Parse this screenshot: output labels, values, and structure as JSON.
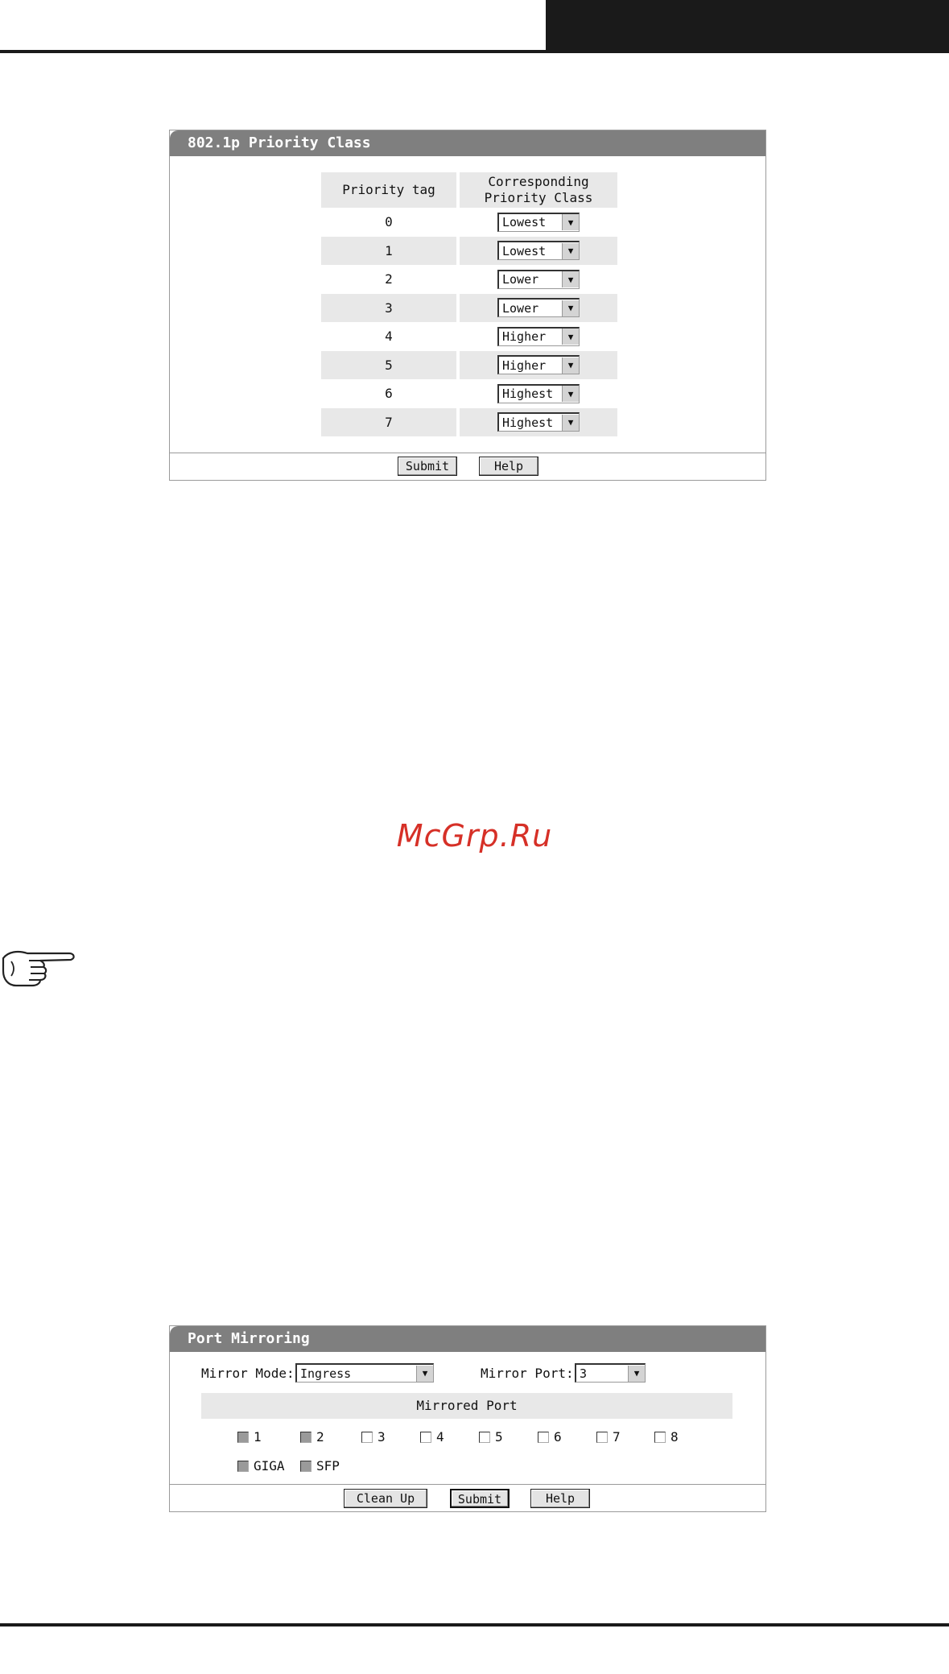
{
  "priority_panel": {
    "title": "802.1p Priority Class",
    "col_tag": "Priority tag",
    "col_class_line1": "Corresponding",
    "col_class_line2": "Priority Class",
    "rows": [
      {
        "tag": "0",
        "class": "Lowest"
      },
      {
        "tag": "1",
        "class": "Lowest"
      },
      {
        "tag": "2",
        "class": "Lower"
      },
      {
        "tag": "3",
        "class": "Lower"
      },
      {
        "tag": "4",
        "class": "Higher"
      },
      {
        "tag": "5",
        "class": "Higher"
      },
      {
        "tag": "6",
        "class": "Highest"
      },
      {
        "tag": "7",
        "class": "Highest"
      }
    ],
    "submit_label": "Submit",
    "help_label": "Help"
  },
  "watermark": "McGrp.Ru",
  "icons": {
    "note": "pointing-hand-icon",
    "dropdown": "chevron-down-icon"
  },
  "mirror_panel": {
    "title": "Port Mirroring",
    "mode_label": "Mirror Mode:",
    "mode_value": "Ingress",
    "port_label": "Mirror Port:",
    "port_value": "3",
    "mirrored_header": "Mirrored Port",
    "ports": [
      {
        "label": "1",
        "disabled": true
      },
      {
        "label": "2",
        "disabled": true
      },
      {
        "label": "3",
        "disabled": false
      },
      {
        "label": "4",
        "disabled": false
      },
      {
        "label": "5",
        "disabled": false
      },
      {
        "label": "6",
        "disabled": false
      },
      {
        "label": "7",
        "disabled": false
      },
      {
        "label": "8",
        "disabled": false
      },
      {
        "label": "GIGA",
        "disabled": true
      },
      {
        "label": "SFP",
        "disabled": true
      }
    ],
    "cleanup_label": "Clean Up",
    "submit_label": "Submit",
    "help_label": "Help"
  }
}
